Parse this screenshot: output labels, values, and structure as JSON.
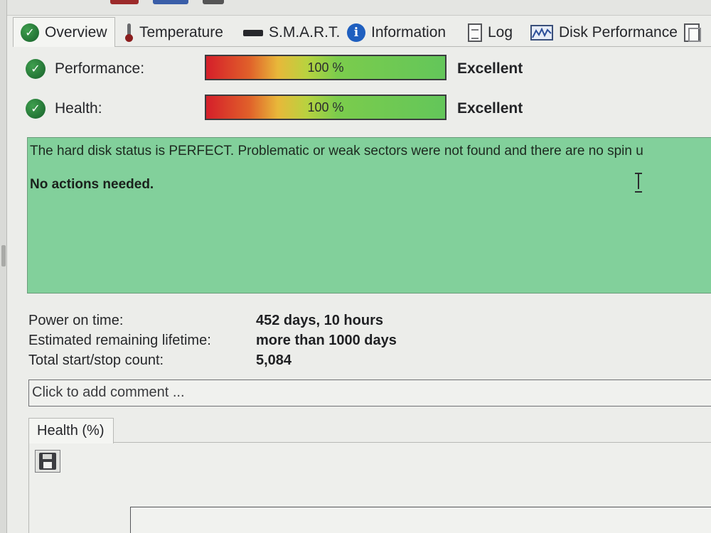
{
  "tabs": [
    {
      "label": "Overview",
      "icon": "check-circle-icon"
    },
    {
      "label": "Temperature",
      "icon": "thermometer-icon"
    },
    {
      "label": "S.M.A.R.T.",
      "icon": "drive-bar-icon"
    },
    {
      "label": "Information",
      "icon": "info-icon"
    },
    {
      "label": "Log",
      "icon": "document-icon"
    },
    {
      "label": "Disk Performance",
      "icon": "chart-icon"
    },
    {
      "label": "",
      "icon": "copy-icon"
    }
  ],
  "performance": {
    "label": "Performance:",
    "value": 1.0,
    "bar_text": "100 %",
    "rating": "Excellent"
  },
  "health": {
    "label": "Health:",
    "value": 1.0,
    "bar_text": "100 %",
    "rating": "Excellent"
  },
  "status": {
    "message": "The hard disk status is PERFECT. Problematic or weak sectors were not found and there are no spin u",
    "action": "No actions needed.",
    "background": "#82d09b"
  },
  "info": [
    {
      "label": "Power on time:",
      "value": "452 days, 10 hours"
    },
    {
      "label": "Estimated remaining lifetime:",
      "value": "more than 1000 days"
    },
    {
      "label": "Total start/stop count:",
      "value": "5,084"
    }
  ],
  "comment_placeholder": "Click to add comment ...",
  "chart_tab": {
    "label": "Health (%)"
  },
  "colors": {
    "ok_green": "#1f7a33",
    "bar_red": "#d51f2a",
    "bar_green": "#63c65a"
  }
}
